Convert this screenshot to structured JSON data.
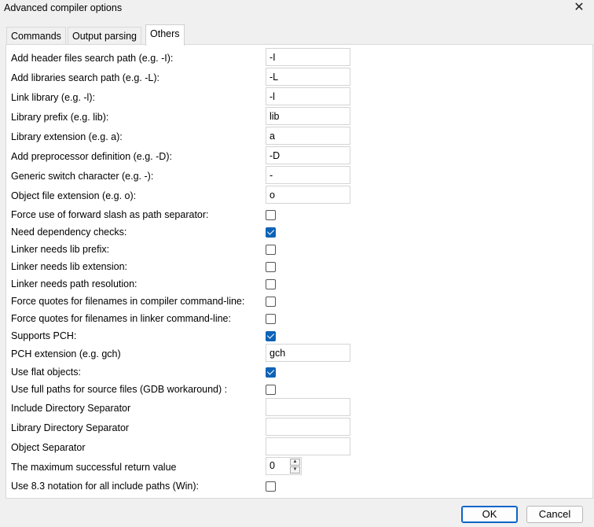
{
  "window": {
    "title": "Advanced compiler options",
    "close_icon": "✕"
  },
  "tabs": [
    {
      "label": "Commands"
    },
    {
      "label": "Output parsing"
    },
    {
      "label": "Others"
    }
  ],
  "fields": {
    "header_search": {
      "label": "Add header files search path (e.g. -I):",
      "value": "-I"
    },
    "lib_search": {
      "label": "Add libraries search path (e.g. -L):",
      "value": "-L"
    },
    "link_library": {
      "label": "Link library (e.g. -l):",
      "value": "-l"
    },
    "lib_prefix": {
      "label": "Library prefix (e.g. lib):",
      "value": "lib"
    },
    "lib_extension": {
      "label": "Library extension (e.g. a):",
      "value": "a"
    },
    "preproc_def": {
      "label": "Add preprocessor definition (e.g. -D):",
      "value": "-D"
    },
    "switch_char": {
      "label": "Generic switch character (e.g. -):",
      "value": "-"
    },
    "object_ext": {
      "label": "Object file extension (e.g. o):",
      "value": "o"
    },
    "pch_ext": {
      "label": "PCH extension (e.g. gch)",
      "value": "gch"
    },
    "include_dir_sep": {
      "label": "Include Directory Separator",
      "value": ""
    },
    "library_dir_sep": {
      "label": "Library Directory Separator",
      "value": ""
    },
    "object_sep": {
      "label": "Object Separator",
      "value": ""
    },
    "max_return": {
      "label": "The maximum successful return value",
      "value": "0"
    }
  },
  "checks": {
    "forward_slash": {
      "label": "Force use of forward slash as path separator:",
      "checked": false
    },
    "dependency": {
      "label": "Need dependency checks:",
      "checked": true
    },
    "lib_prefix": {
      "label": "Linker needs lib prefix:",
      "checked": false
    },
    "lib_extension": {
      "label": "Linker needs lib extension:",
      "checked": false
    },
    "path_resolution": {
      "label": "Linker needs path resolution:",
      "checked": false
    },
    "quotes_compiler": {
      "label": "Force quotes for filenames in compiler command-line:",
      "checked": false
    },
    "quotes_linker": {
      "label": "Force quotes for filenames in linker command-line:",
      "checked": false
    },
    "supports_pch": {
      "label": "Supports PCH:",
      "checked": true
    },
    "flat_objects": {
      "label": "Use flat objects:",
      "checked": true
    },
    "full_paths": {
      "label": "Use full paths for source files (GDB workaround) :",
      "checked": false
    },
    "notation_83": {
      "label": "Use 8.3 notation for all include paths (Win):",
      "checked": false
    }
  },
  "buttons": {
    "ok": "OK",
    "cancel": "Cancel"
  },
  "colors": {
    "accent": "#0e63b7",
    "background": "#f0f0f0",
    "panel": "#ffffff"
  }
}
